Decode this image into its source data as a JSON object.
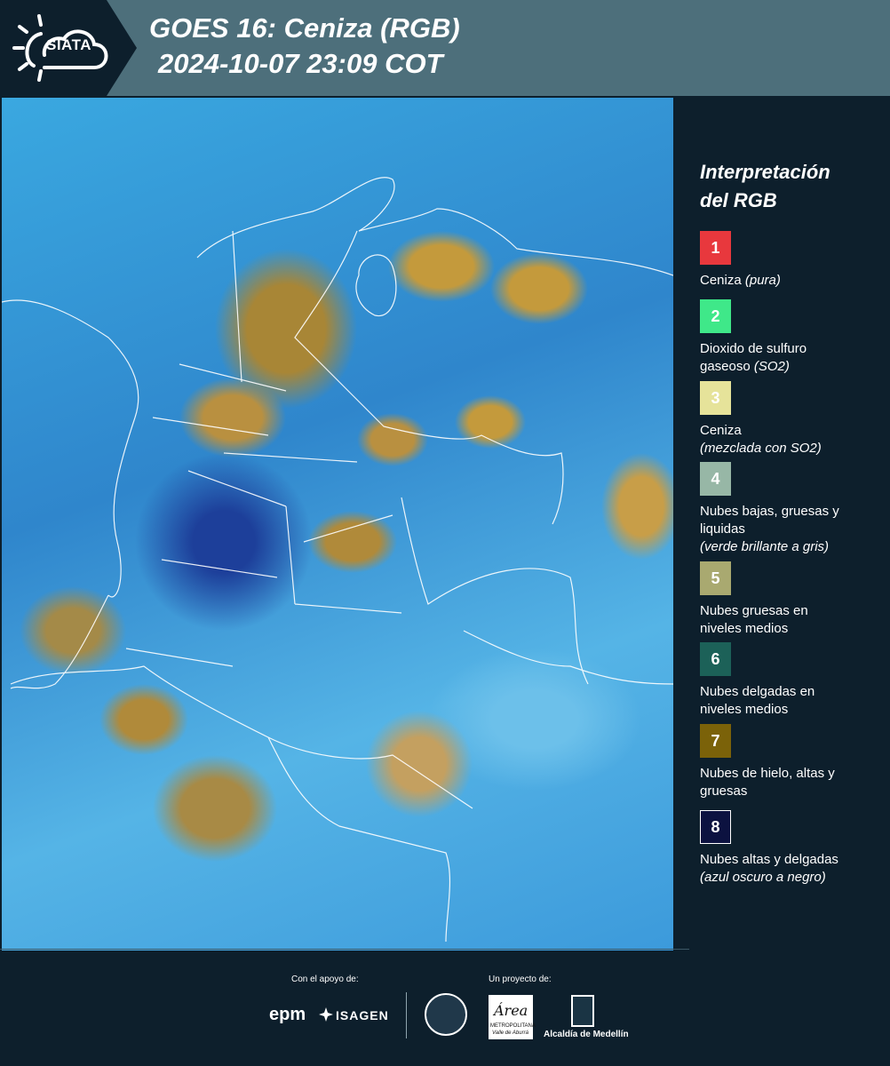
{
  "header": {
    "logo_text": "SIATA",
    "title_line1": "GOES 16: Ceniza (RGB)",
    "title_line2": "2024-10-07 23:09 COT"
  },
  "legend": {
    "title_line1": "Interpretación",
    "title_line2": "del RGB",
    "items": [
      {
        "number": "1",
        "color": "#e8383d",
        "text_lines": [
          "Ceniza"
        ],
        "note": "(pura)",
        "note_inline": true
      },
      {
        "number": "2",
        "color": "#3fe889",
        "text_lines": [
          "Dioxido de sulfuro",
          "gaseoso"
        ],
        "note": "(SO2)",
        "note_inline": true
      },
      {
        "number": "3",
        "color": "#e6e39a",
        "text_lines": [
          "Ceniza"
        ],
        "note": "(mezclada con SO2)",
        "note_inline": false
      },
      {
        "number": "4",
        "color": "#97b7a6",
        "text_lines": [
          "Nubes bajas, gruesas y",
          "liquidas"
        ],
        "note": "(verde brillante a gris)",
        "note_inline": false
      },
      {
        "number": "5",
        "color": "#a9a970",
        "text_lines": [
          "Nubes gruesas en",
          "niveles medios"
        ],
        "note": "",
        "note_inline": false
      },
      {
        "number": "6",
        "color": "#1c6158",
        "text_lines": [
          "Nubes delgadas en",
          "niveles medios"
        ],
        "note": "",
        "note_inline": false
      },
      {
        "number": "7",
        "color": "#7b6209",
        "text_lines": [
          "Nubes de hielo, altas y",
          "gruesas"
        ],
        "note": "",
        "note_inline": false
      },
      {
        "number": "8",
        "color": "#0c1240",
        "text_lines": [
          "Nubes altas y delgadas"
        ],
        "note": "(azul oscuro a negro)",
        "note_inline": false
      }
    ]
  },
  "footer": {
    "support_label": "Con el apoyo de:",
    "project_label": "Un proyecto de:",
    "epm": "epm",
    "isagen": "ISAGEN",
    "area_text": "Área",
    "area_sub": "METROPOLITANA",
    "area_sub2": "Valle de Aburrá",
    "alcaldia": "Alcaldía de Medellín"
  }
}
